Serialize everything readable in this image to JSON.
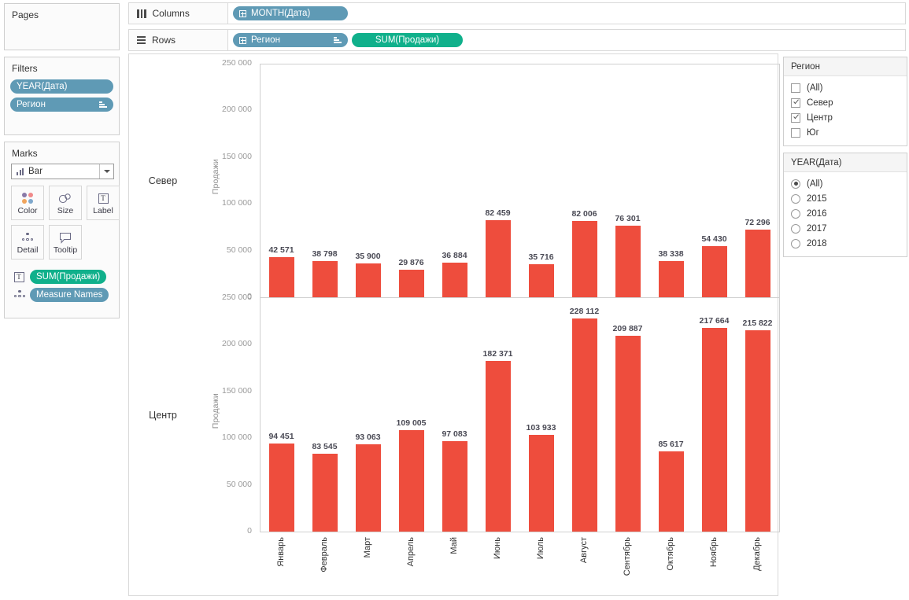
{
  "left_panel": {
    "pages_title": "Pages",
    "filters_title": "Filters",
    "filters": [
      {
        "label": "YEAR(Дата)",
        "color": "#5f9ab5",
        "has_sort": false
      },
      {
        "label": "Регион",
        "color": "#5f9ab5",
        "has_sort": true
      }
    ],
    "marks_title": "Marks",
    "marks_type": "Bar",
    "marks_type_icon": "bar-chart-icon",
    "marks_buttons": [
      {
        "label": "Color",
        "icon": "color-dots-icon"
      },
      {
        "label": "Size",
        "icon": "size-circles-icon"
      },
      {
        "label": "Label",
        "icon": "text-label-icon"
      },
      {
        "label": "Detail",
        "icon": "detail-dots-icon"
      },
      {
        "label": "Tooltip",
        "icon": "tooltip-bubble-icon"
      }
    ],
    "marks_pills": [
      {
        "label": "SUM(Продажи)",
        "color": "#10b08b",
        "icon": "text-label-icon"
      },
      {
        "label": "Measure Names",
        "color": "#5f9ab5",
        "icon": "detail-dots-icon"
      }
    ]
  },
  "shelves": {
    "columns_label": "Columns",
    "columns_icon": "columns-icon",
    "columns_pills": [
      {
        "label": "MONTH(Дата)",
        "color": "#5f9ab5",
        "expandable": true,
        "has_sort": false
      }
    ],
    "rows_label": "Rows",
    "rows_icon": "rows-icon",
    "rows_pills": [
      {
        "label": "Регион",
        "color": "#5f9ab5",
        "expandable": true,
        "has_sort": true
      },
      {
        "label": "SUM(Продажи)",
        "color": "#10b08b",
        "expandable": false,
        "has_sort": false
      }
    ]
  },
  "right_filters": [
    {
      "title": "Регион",
      "control": "checkbox",
      "options": [
        {
          "label": "(All)",
          "checked": false
        },
        {
          "label": "Север",
          "checked": true
        },
        {
          "label": "Центр",
          "checked": true
        },
        {
          "label": "Юг",
          "checked": false
        }
      ]
    },
    {
      "title": "YEAR(Дата)",
      "control": "radio",
      "options": [
        {
          "label": "(All)",
          "checked": true
        },
        {
          "label": "2015",
          "checked": false
        },
        {
          "label": "2016",
          "checked": false
        },
        {
          "label": "2017",
          "checked": false
        },
        {
          "label": "2018",
          "checked": false
        }
      ]
    }
  ],
  "chart_data": {
    "type": "bar",
    "title": "",
    "xlabel": "",
    "ylabel": "Продажи",
    "bar_color": "#ee4d3d",
    "grid": false,
    "legend": "none",
    "ylim": [
      0,
      250000
    ],
    "yticks": [
      0,
      50000,
      100000,
      150000,
      200000,
      250000
    ],
    "ytick_labels": [
      "0",
      "50 000",
      "100 000",
      "150 000",
      "200 000",
      "250 000"
    ],
    "categories": [
      "Январь",
      "Февраль",
      "Март",
      "Апрель",
      "Май",
      "Июнь",
      "Июль",
      "Август",
      "Сентябрь",
      "Октябрь",
      "Ноябрь",
      "Декабрь"
    ],
    "panels": [
      {
        "row_label": "Север",
        "values": [
          42571,
          38798,
          35900,
          29876,
          36884,
          82459,
          35716,
          82006,
          76301,
          38338,
          54430,
          72296
        ],
        "value_labels": [
          "42 571",
          "38 798",
          "35 900",
          "29 876",
          "36 884",
          "82 459",
          "35 716",
          "82 006",
          "76 301",
          "38 338",
          "54 430",
          "72 296"
        ]
      },
      {
        "row_label": "Центр",
        "values": [
          94451,
          83545,
          93063,
          109005,
          97083,
          182371,
          103933,
          228112,
          209887,
          85617,
          217664,
          215822
        ],
        "value_labels": [
          "94 451",
          "83 545",
          "93 063",
          "109 005",
          "97 083",
          "182 371",
          "103 933",
          "228 112",
          "209 887",
          "85 617",
          "217 664",
          "215 822"
        ]
      }
    ]
  }
}
